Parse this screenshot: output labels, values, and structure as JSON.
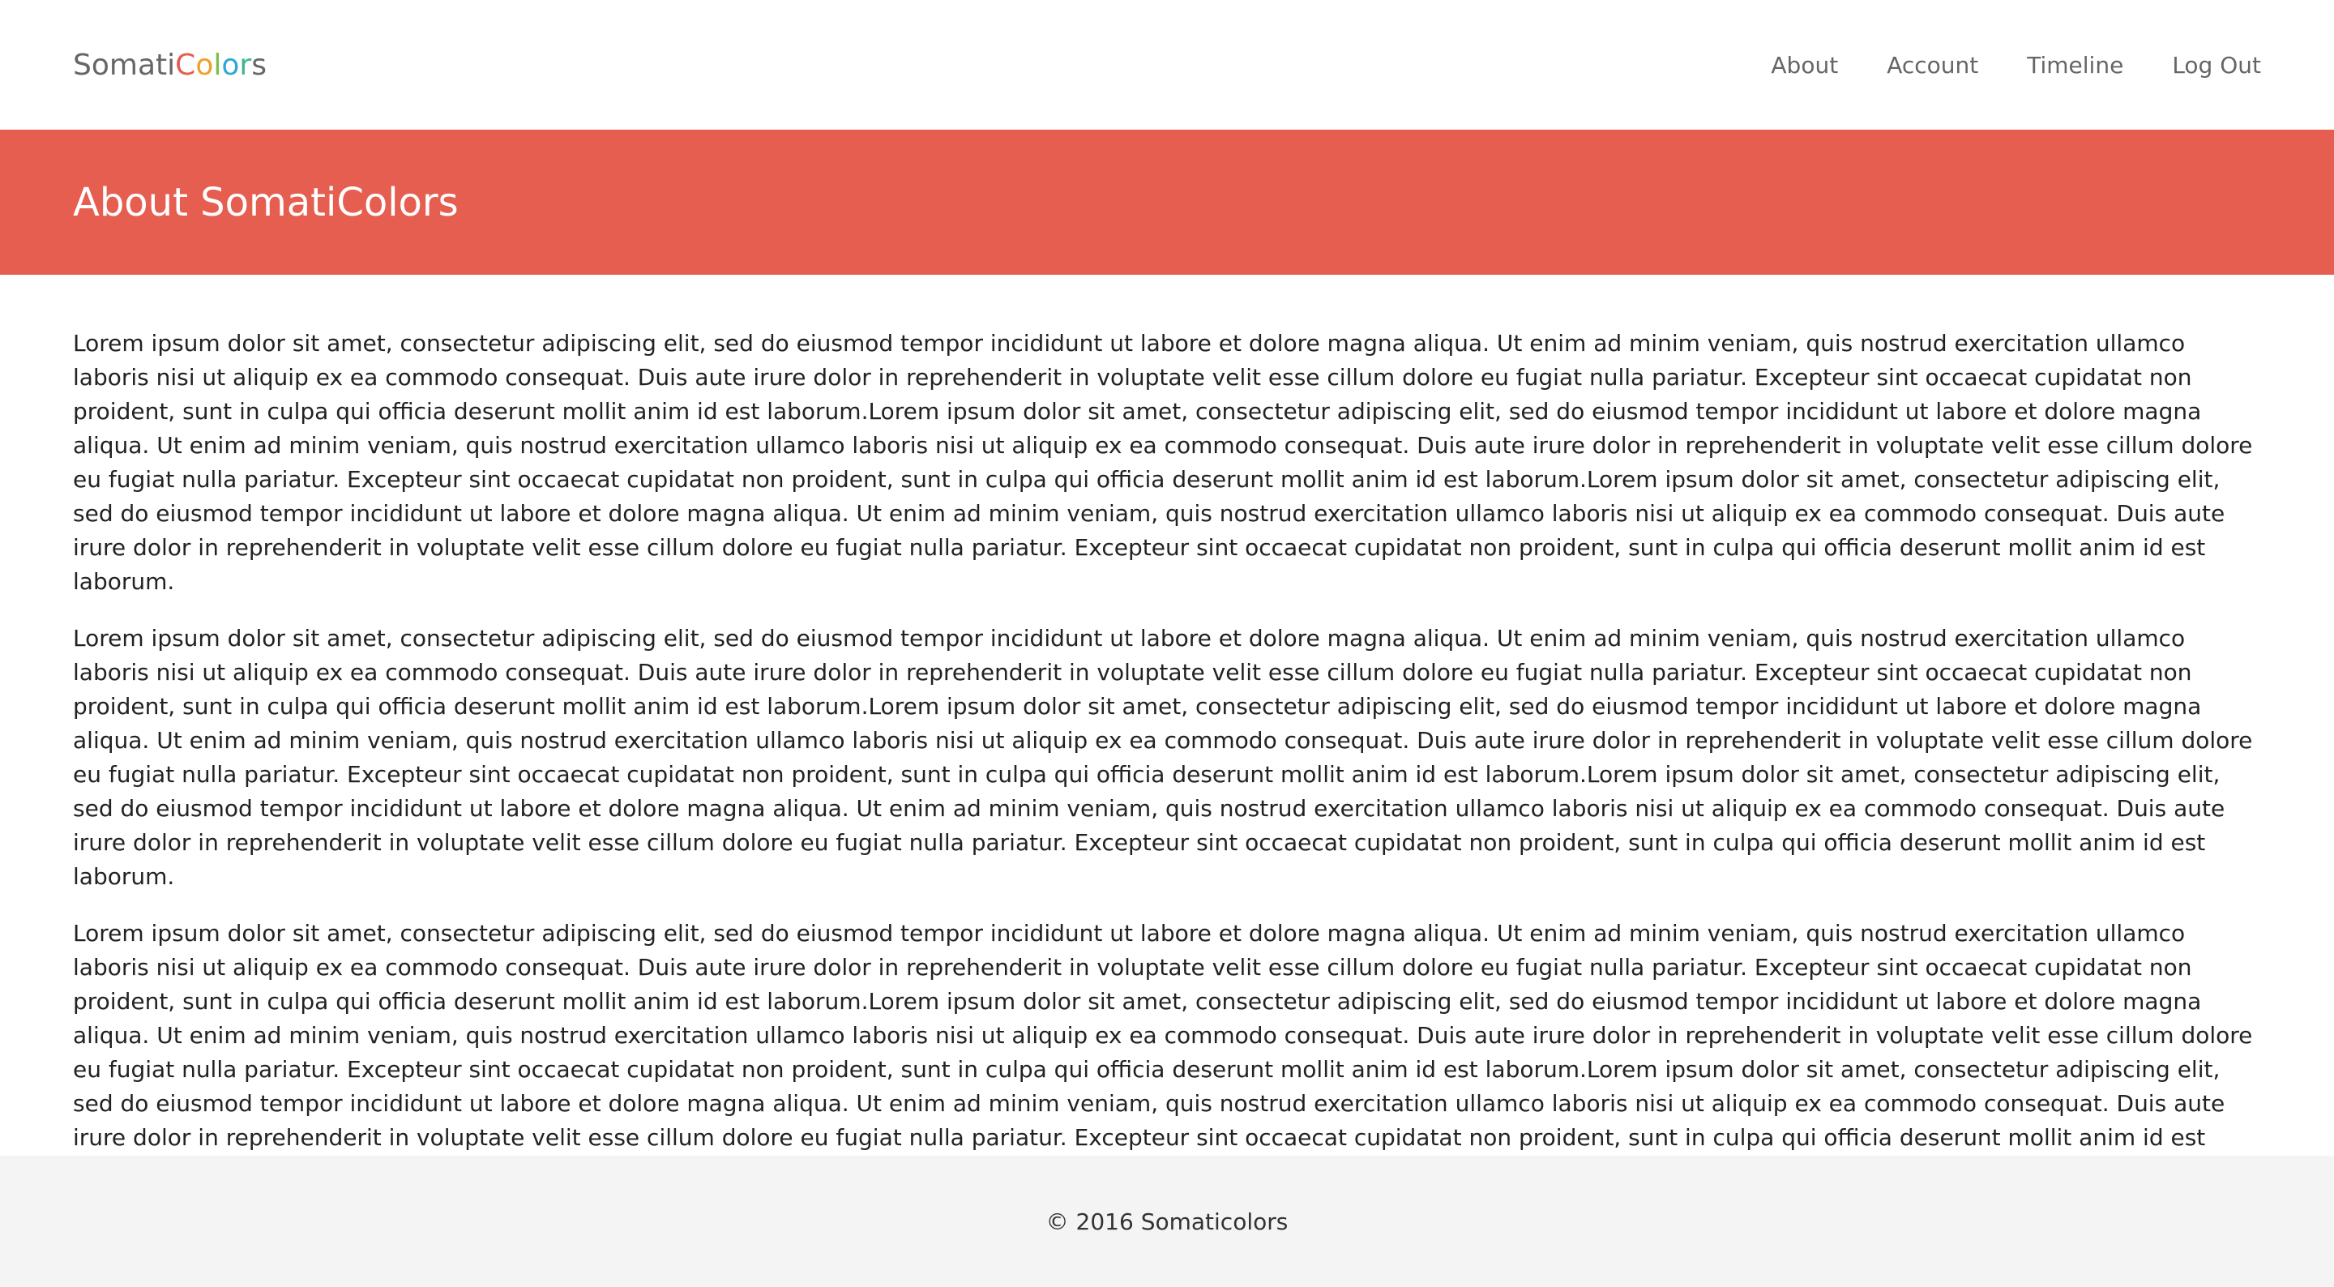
{
  "brand": {
    "letters": [
      {
        "ch": "S",
        "color": "#666666"
      },
      {
        "ch": "o",
        "color": "#666666"
      },
      {
        "ch": "m",
        "color": "#666666"
      },
      {
        "ch": "a",
        "color": "#666666"
      },
      {
        "ch": "t",
        "color": "#666666"
      },
      {
        "ch": "i",
        "color": "#666666"
      },
      {
        "ch": "C",
        "color": "#e55e4f"
      },
      {
        "ch": "o",
        "color": "#f0a02b"
      },
      {
        "ch": "l",
        "color": "#7cc04b"
      },
      {
        "ch": "o",
        "color": "#2fa8d8"
      },
      {
        "ch": "r",
        "color": "#3fb68e"
      },
      {
        "ch": "s",
        "color": "#666666"
      }
    ]
  },
  "nav": {
    "items": [
      "About",
      "Account",
      "Timeline",
      "Log Out"
    ]
  },
  "banner": {
    "title": "About SomatiColors",
    "color": "#e55e4f"
  },
  "content": {
    "paragraphs": [
      "Lorem ipsum dolor sit amet, consectetur adipiscing elit, sed do eiusmod tempor incididunt ut labore et dolore magna aliqua. Ut enim ad minim veniam, quis nostrud exercitation ullamco laboris nisi ut aliquip ex ea commodo consequat. Duis aute irure dolor in reprehenderit in voluptate velit esse cillum dolore eu fugiat nulla pariatur. Excepteur sint occaecat cupidatat non proident, sunt in culpa qui officia deserunt mollit anim id est laborum.Lorem ipsum dolor sit amet, consectetur adipiscing elit, sed do eiusmod tempor incididunt ut labore et dolore magna aliqua. Ut enim ad minim veniam, quis nostrud exercitation ullamco laboris nisi ut aliquip ex ea commodo consequat. Duis aute irure dolor in reprehenderit in voluptate velit esse cillum dolore eu fugiat nulla pariatur. Excepteur sint occaecat cupidatat non proident, sunt in culpa qui officia deserunt mollit anim id est laborum.Lorem ipsum dolor sit amet, consectetur adipiscing elit, sed do eiusmod tempor incididunt ut labore et dolore magna aliqua. Ut enim ad minim veniam, quis nostrud exercitation ullamco laboris nisi ut aliquip ex ea commodo consequat. Duis aute irure dolor in reprehenderit in voluptate velit esse cillum dolore eu fugiat nulla pariatur. Excepteur sint occaecat cupidatat non proident, sunt in culpa qui officia deserunt mollit anim id est laborum.",
      "Lorem ipsum dolor sit amet, consectetur adipiscing elit, sed do eiusmod tempor incididunt ut labore et dolore magna aliqua. Ut enim ad minim veniam, quis nostrud exercitation ullamco laboris nisi ut aliquip ex ea commodo consequat. Duis aute irure dolor in reprehenderit in voluptate velit esse cillum dolore eu fugiat nulla pariatur. Excepteur sint occaecat cupidatat non proident, sunt in culpa qui officia deserunt mollit anim id est laborum.Lorem ipsum dolor sit amet, consectetur adipiscing elit, sed do eiusmod tempor incididunt ut labore et dolore magna aliqua. Ut enim ad minim veniam, quis nostrud exercitation ullamco laboris nisi ut aliquip ex ea commodo consequat. Duis aute irure dolor in reprehenderit in voluptate velit esse cillum dolore eu fugiat nulla pariatur. Excepteur sint occaecat cupidatat non proident, sunt in culpa qui officia deserunt mollit anim id est laborum.Lorem ipsum dolor sit amet, consectetur adipiscing elit, sed do eiusmod tempor incididunt ut labore et dolore magna aliqua. Ut enim ad minim veniam, quis nostrud exercitation ullamco laboris nisi ut aliquip ex ea commodo consequat. Duis aute irure dolor in reprehenderit in voluptate velit esse cillum dolore eu fugiat nulla pariatur. Excepteur sint occaecat cupidatat non proident, sunt in culpa qui officia deserunt mollit anim id est laborum.",
      "Lorem ipsum dolor sit amet, consectetur adipiscing elit, sed do eiusmod tempor incididunt ut labore et dolore magna aliqua. Ut enim ad minim veniam, quis nostrud exercitation ullamco laboris nisi ut aliquip ex ea commodo consequat. Duis aute irure dolor in reprehenderit in voluptate velit esse cillum dolore eu fugiat nulla pariatur. Excepteur sint occaecat cupidatat non proident, sunt in culpa qui officia deserunt mollit anim id est laborum.Lorem ipsum dolor sit amet, consectetur adipiscing elit, sed do eiusmod tempor incididunt ut labore et dolore magna aliqua. Ut enim ad minim veniam, quis nostrud exercitation ullamco laboris nisi ut aliquip ex ea commodo consequat. Duis aute irure dolor in reprehenderit in voluptate velit esse cillum dolore eu fugiat nulla pariatur. Excepteur sint occaecat cupidatat non proident, sunt in culpa qui officia deserunt mollit anim id est laborum.Lorem ipsum dolor sit amet, consectetur adipiscing elit, sed do eiusmod tempor incididunt ut labore et dolore magna aliqua. Ut enim ad minim veniam, quis nostrud exercitation ullamco laboris nisi ut aliquip ex ea commodo consequat. Duis aute irure dolor in reprehenderit in voluptate velit esse cillum dolore eu fugiat nulla pariatur. Excepteur sint occaecat cupidatat non proident, sunt in culpa qui officia deserunt mollit anim id est laborum."
    ]
  },
  "footer": {
    "copyright": "© 2016 Somaticolors"
  }
}
